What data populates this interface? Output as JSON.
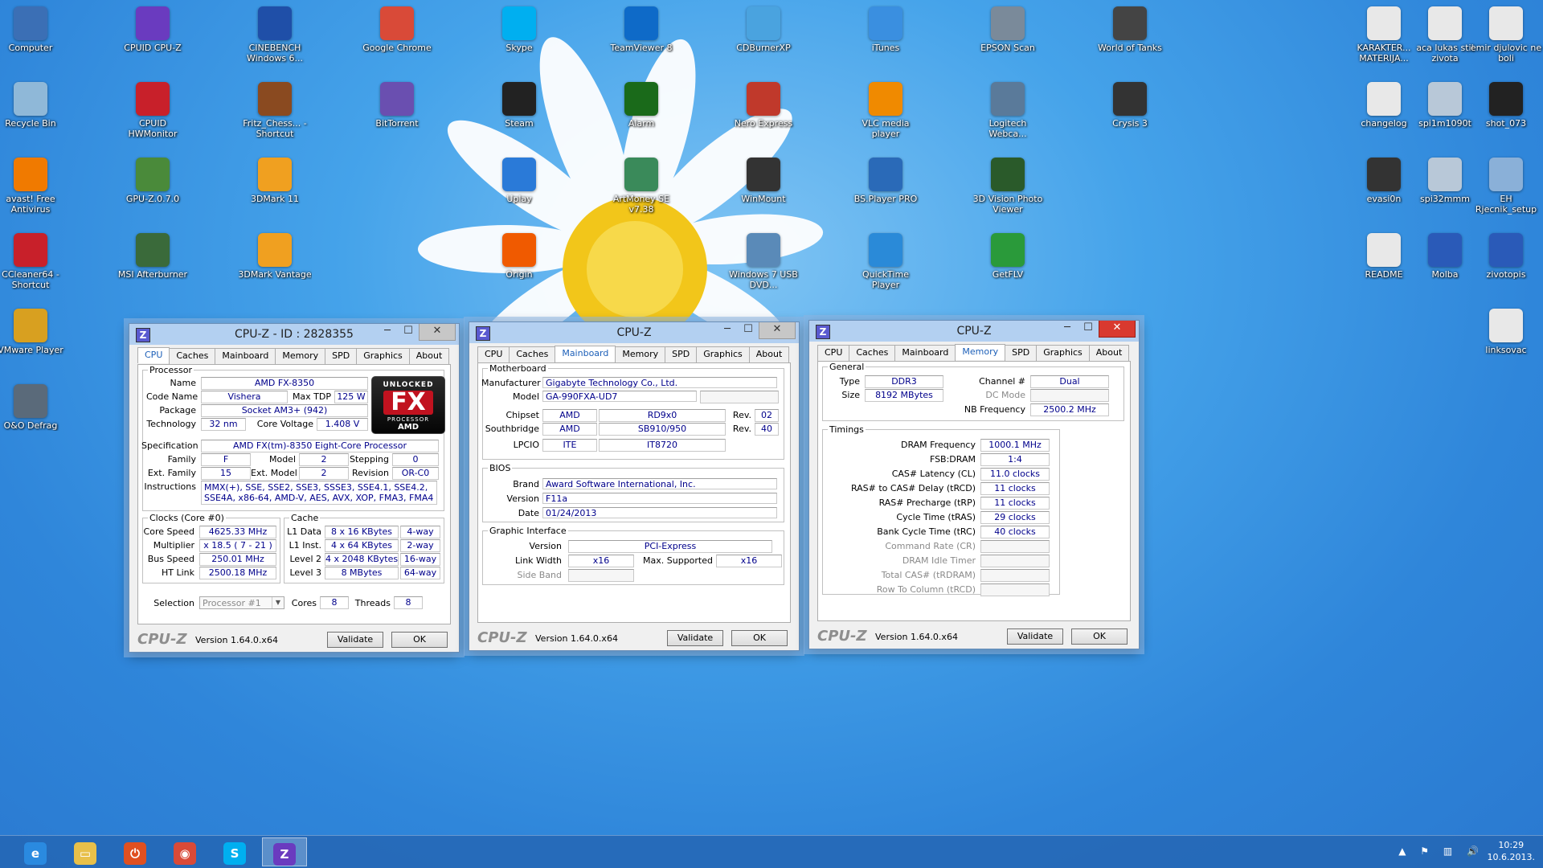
{
  "desktop_icons": [
    {
      "label": "Computer",
      "icon": "computer-icon",
      "color": "#3b6fb5"
    },
    {
      "label": "CPUID CPU-Z",
      "icon": "cpuz-icon",
      "color": "#6a3bbf"
    },
    {
      "label": "CINEBENCH Windows 6...",
      "icon": "cinebench-icon",
      "color": "#1f4fa8"
    },
    {
      "label": "Google Chrome",
      "icon": "chrome-icon",
      "color": "#d94a38"
    },
    {
      "label": "Skype",
      "icon": "skype-icon",
      "color": "#00aff0"
    },
    {
      "label": "TeamViewer 8",
      "icon": "teamviewer-icon",
      "color": "#0e6ac8"
    },
    {
      "label": "CDBurnerXP",
      "icon": "cdburner-icon",
      "color": "#4aa3df"
    },
    {
      "label": "iTunes",
      "icon": "itunes-icon",
      "color": "#3a8fe0"
    },
    {
      "label": "EPSON Scan",
      "icon": "scanner-icon",
      "color": "#7a8a9a"
    },
    {
      "label": "World of Tanks",
      "icon": "wot-icon",
      "color": "#444444"
    },
    {
      "label": "KARAKTER... MATERIJA...",
      "icon": "document-icon",
      "color": "#e8e8e8"
    },
    {
      "label": "aca lukas stil zivota",
      "icon": "document-icon",
      "color": "#e8e8e8"
    },
    {
      "label": "emir djulovic ne boli",
      "icon": "document-icon",
      "color": "#e8e8e8"
    },
    {
      "label": "Recycle Bin",
      "icon": "recycle-bin-icon",
      "color": "#8fb8d8"
    },
    {
      "label": "CPUID HWMonitor",
      "icon": "hwmonitor-icon",
      "color": "#c8202a"
    },
    {
      "label": "Fritz_Chess... - Shortcut",
      "icon": "chess-icon",
      "color": "#8a4a20"
    },
    {
      "label": "BitTorrent",
      "icon": "bittorrent-icon",
      "color": "#6a4fb0"
    },
    {
      "label": "Steam",
      "icon": "steam-icon",
      "color": "#222222"
    },
    {
      "label": "Alarm",
      "icon": "alarm-icon",
      "color": "#1a6a1a"
    },
    {
      "label": "Nero Express",
      "icon": "nero-icon",
      "color": "#c0392b"
    },
    {
      "label": "VLC media player",
      "icon": "vlc-icon",
      "color": "#f08a00"
    },
    {
      "label": "Logitech Webca...",
      "icon": "webcam-icon",
      "color": "#5a7a9a"
    },
    {
      "label": "Crysis 3",
      "icon": "crysis-icon",
      "color": "#333333"
    },
    {
      "label": "changelog",
      "icon": "document-icon",
      "color": "#e8e8e8"
    },
    {
      "label": "spi1m1090t",
      "icon": "image-icon",
      "color": "#b8c8d8"
    },
    {
      "label": "shot_073",
      "icon": "image-icon",
      "color": "#222222"
    },
    {
      "label": "avast! Free Antivirus",
      "icon": "avast-icon",
      "color": "#f07a00"
    },
    {
      "label": "GPU-Z.0.7.0",
      "icon": "gpuz-icon",
      "color": "#4a8a3a"
    },
    {
      "label": "3DMark 11",
      "icon": "3dmark-icon",
      "color": "#f0a020"
    },
    {
      "label": "Uplay",
      "icon": "uplay-icon",
      "color": "#2a7ad8"
    },
    {
      "label": "ArtMoney SE v7.38",
      "icon": "artmoney-icon",
      "color": "#3a8a5a"
    },
    {
      "label": "WinMount",
      "icon": "winmount-icon",
      "color": "#333333"
    },
    {
      "label": "BS.Player PRO",
      "icon": "bsplayer-icon",
      "color": "#2a6ab8"
    },
    {
      "label": "3D Vision Photo Viewer",
      "icon": "3dvision-icon",
      "color": "#2a5a2a"
    },
    {
      "label": "evasi0n",
      "icon": "evasion-icon",
      "color": "#333333"
    },
    {
      "label": "spi32mmm",
      "icon": "image-icon",
      "color": "#b8c8d8"
    },
    {
      "label": "EH Rjecnik_setup",
      "icon": "setup-icon",
      "color": "#8ab0d8"
    },
    {
      "label": "CCleaner64 - Shortcut",
      "icon": "ccleaner-icon",
      "color": "#c8202a"
    },
    {
      "label": "MSI Afterburner",
      "icon": "afterburner-icon",
      "color": "#3a6a3a"
    },
    {
      "label": "3DMark Vantage",
      "icon": "3dmark-vantage-icon",
      "color": "#f0a020"
    },
    {
      "label": "Origin",
      "icon": "origin-icon",
      "color": "#f05a00"
    },
    {
      "label": "Windows 7 USB DVD...",
      "icon": "usb-dvd-icon",
      "color": "#5a8ab8"
    },
    {
      "label": "QuickTime Player",
      "icon": "quicktime-icon",
      "color": "#2a8ad8"
    },
    {
      "label": "GetFLV",
      "icon": "getflv-icon",
      "color": "#2a9a3a"
    },
    {
      "label": "README",
      "icon": "document-icon",
      "color": "#e8e8e8"
    },
    {
      "label": "Molba",
      "icon": "word-doc-icon",
      "color": "#2a5ab8"
    },
    {
      "label": "zivotopis",
      "icon": "word-doc-icon",
      "color": "#2a5ab8"
    },
    {
      "label": "VMware Player",
      "icon": "vmware-icon",
      "color": "#d8a020"
    },
    {
      "label": "linksovac",
      "icon": "document-icon",
      "color": "#e8e8e8"
    },
    {
      "label": "O&O Defrag",
      "icon": "defrag-icon",
      "color": "#5a6a7a"
    }
  ],
  "cpu_window": {
    "title": "CPU-Z - ID : 2828355",
    "tabs": [
      "CPU",
      "Caches",
      "Mainboard",
      "Memory",
      "SPD",
      "Graphics",
      "About"
    ],
    "processor_legend": "Processor",
    "name_label": "Name",
    "name": "AMD FX-8350",
    "codename_label": "Code Name",
    "codename": "Vishera",
    "maxtdp_label": "Max TDP",
    "maxtdp": "125 W",
    "package_label": "Package",
    "package": "Socket AM3+ (942)",
    "technology_label": "Technology",
    "technology": "32 nm",
    "corevoltage_label": "Core Voltage",
    "corevoltage": "1.408 V",
    "spec_label": "Specification",
    "spec": "AMD FX(tm)-8350 Eight-Core Processor",
    "family_label": "Family",
    "family": "F",
    "model_label": "Model",
    "model": "2",
    "stepping_label": "Stepping",
    "stepping": "0",
    "extfamily_label": "Ext. Family",
    "extfamily": "15",
    "extmodel_label": "Ext. Model",
    "extmodel": "2",
    "revision_label": "Revision",
    "revision": "OR-C0",
    "instructions_label": "Instructions",
    "instructions": "MMX(+), SSE, SSE2, SSE3, SSSE3, SSE4.1, SSE4.2, SSE4A, x86-64, AMD-V, AES, AVX, XOP, FMA3, FMA4",
    "logo": {
      "top": "UNLOCKED",
      "fx": "FX",
      "sub": "PROCESSOR",
      "amd": "AMD"
    },
    "clocks_legend": "Clocks (Core #0)",
    "corespeed_label": "Core Speed",
    "corespeed": "4625.33 MHz",
    "multiplier_label": "Multiplier",
    "multiplier": "x 18.5 ( 7 - 21 )",
    "busspeed_label": "Bus Speed",
    "busspeed": "250.01 MHz",
    "htlink_label": "HT Link",
    "htlink": "2500.18 MHz",
    "cache_legend": "Cache",
    "l1data_label": "L1 Data",
    "l1data": "8 x 16 KBytes",
    "l1data_way": "4-way",
    "l1inst_label": "L1 Inst.",
    "l1inst": "4 x 64 KBytes",
    "l1inst_way": "2-way",
    "l2_label": "Level 2",
    "l2": "4 x 2048 KBytes",
    "l2_way": "16-way",
    "l3_label": "Level 3",
    "l3": "8 MBytes",
    "l3_way": "64-way",
    "selection_label": "Selection",
    "selection": "Processor #1",
    "cores_label": "Cores",
    "cores": "8",
    "threads_label": "Threads",
    "threads": "8",
    "brand": "CPU-Z",
    "version": "Version 1.64.0.x64",
    "validate": "Validate",
    "ok": "OK"
  },
  "mainboard_window": {
    "title": "CPU-Z",
    "tabs": [
      "CPU",
      "Caches",
      "Mainboard",
      "Memory",
      "SPD",
      "Graphics",
      "About"
    ],
    "motherboard_legend": "Motherboard",
    "manufacturer_label": "Manufacturer",
    "manufacturer": "Gigabyte Technology Co., Ltd.",
    "model_label": "Model",
    "model": "GA-990FXA-UD7",
    "chipset_label": "Chipset",
    "chipset_vendor": "AMD",
    "chipset": "RD9x0",
    "chipset_rev_label": "Rev.",
    "chipset_rev": "02",
    "southbridge_label": "Southbridge",
    "southbridge_vendor": "AMD",
    "southbridge": "SB910/950",
    "southbridge_rev_label": "Rev.",
    "southbridge_rev": "40",
    "lpcio_label": "LPCIO",
    "lpcio_vendor": "ITE",
    "lpcio": "IT8720",
    "bios_legend": "BIOS",
    "brand_label": "Brand",
    "bios_brand": "Award Software International, Inc.",
    "version_label": "Version",
    "bios_version": "F11a",
    "date_label": "Date",
    "bios_date": "01/24/2013",
    "graphic_legend": "Graphic Interface",
    "gi_version_label": "Version",
    "gi_version": "PCI-Express",
    "linkwidth_label": "Link Width",
    "linkwidth": "x16",
    "maxsupported_label": "Max. Supported",
    "maxsupported": "x16",
    "sideband_label": "Side Band",
    "brand": "CPU-Z",
    "version": "Version 1.64.0.x64",
    "validate": "Validate",
    "ok": "OK"
  },
  "memory_window": {
    "title": "CPU-Z",
    "tabs": [
      "CPU",
      "Caches",
      "Mainboard",
      "Memory",
      "SPD",
      "Graphics",
      "About"
    ],
    "general_legend": "General",
    "type_label": "Type",
    "type": "DDR3",
    "size_label": "Size",
    "size": "8192 MBytes",
    "channel_label": "Channel #",
    "channel": "Dual",
    "dcmode_label": "DC Mode",
    "nbfreq_label": "NB Frequency",
    "nbfreq": "2500.2 MHz",
    "timings_legend": "Timings",
    "dramfreq_label": "DRAM Frequency",
    "dramfreq": "1000.1 MHz",
    "fsbdram_label": "FSB:DRAM",
    "fsbdram": "1:4",
    "cl_label": "CAS# Latency (CL)",
    "cl": "11.0 clocks",
    "trcd_label": "RAS# to CAS# Delay (tRCD)",
    "trcd": "11 clocks",
    "trp_label": "RAS# Precharge (tRP)",
    "trp": "11 clocks",
    "tras_label": "Cycle Time (tRAS)",
    "tras": "29 clocks",
    "trc_label": "Bank Cycle Time (tRC)",
    "trc": "40 clocks",
    "cr_label": "Command Rate (CR)",
    "idle_label": "DRAM Idle Timer",
    "trdram_label": "Total CAS# (tRDRAM)",
    "rowcol_label": "Row To Column (tRCD)",
    "brand": "CPU-Z",
    "version": "Version 1.64.0.x64",
    "validate": "Validate",
    "ok": "OK"
  },
  "taskbar": {
    "apps": [
      {
        "name": "taskbar-internet-explorer",
        "icon": "internet-explorer-icon",
        "glyph": "e",
        "color": "#2a8ae0"
      },
      {
        "name": "taskbar-file-explorer",
        "icon": "folder-icon",
        "glyph": "▭",
        "color": "#e8c04a"
      },
      {
        "name": "taskbar-power",
        "icon": "power-icon",
        "glyph": "⏻",
        "color": "#e05020"
      },
      {
        "name": "taskbar-chrome",
        "icon": "chrome-icon",
        "glyph": "◉",
        "color": "#d94a38"
      },
      {
        "name": "taskbar-skype",
        "icon": "skype-icon",
        "glyph": "S",
        "color": "#00aff0"
      },
      {
        "name": "taskbar-cpuz",
        "icon": "cpuz-icon",
        "glyph": "Z",
        "color": "#6a3bbf"
      }
    ],
    "time": "10:29",
    "date": "10.6.2013."
  }
}
